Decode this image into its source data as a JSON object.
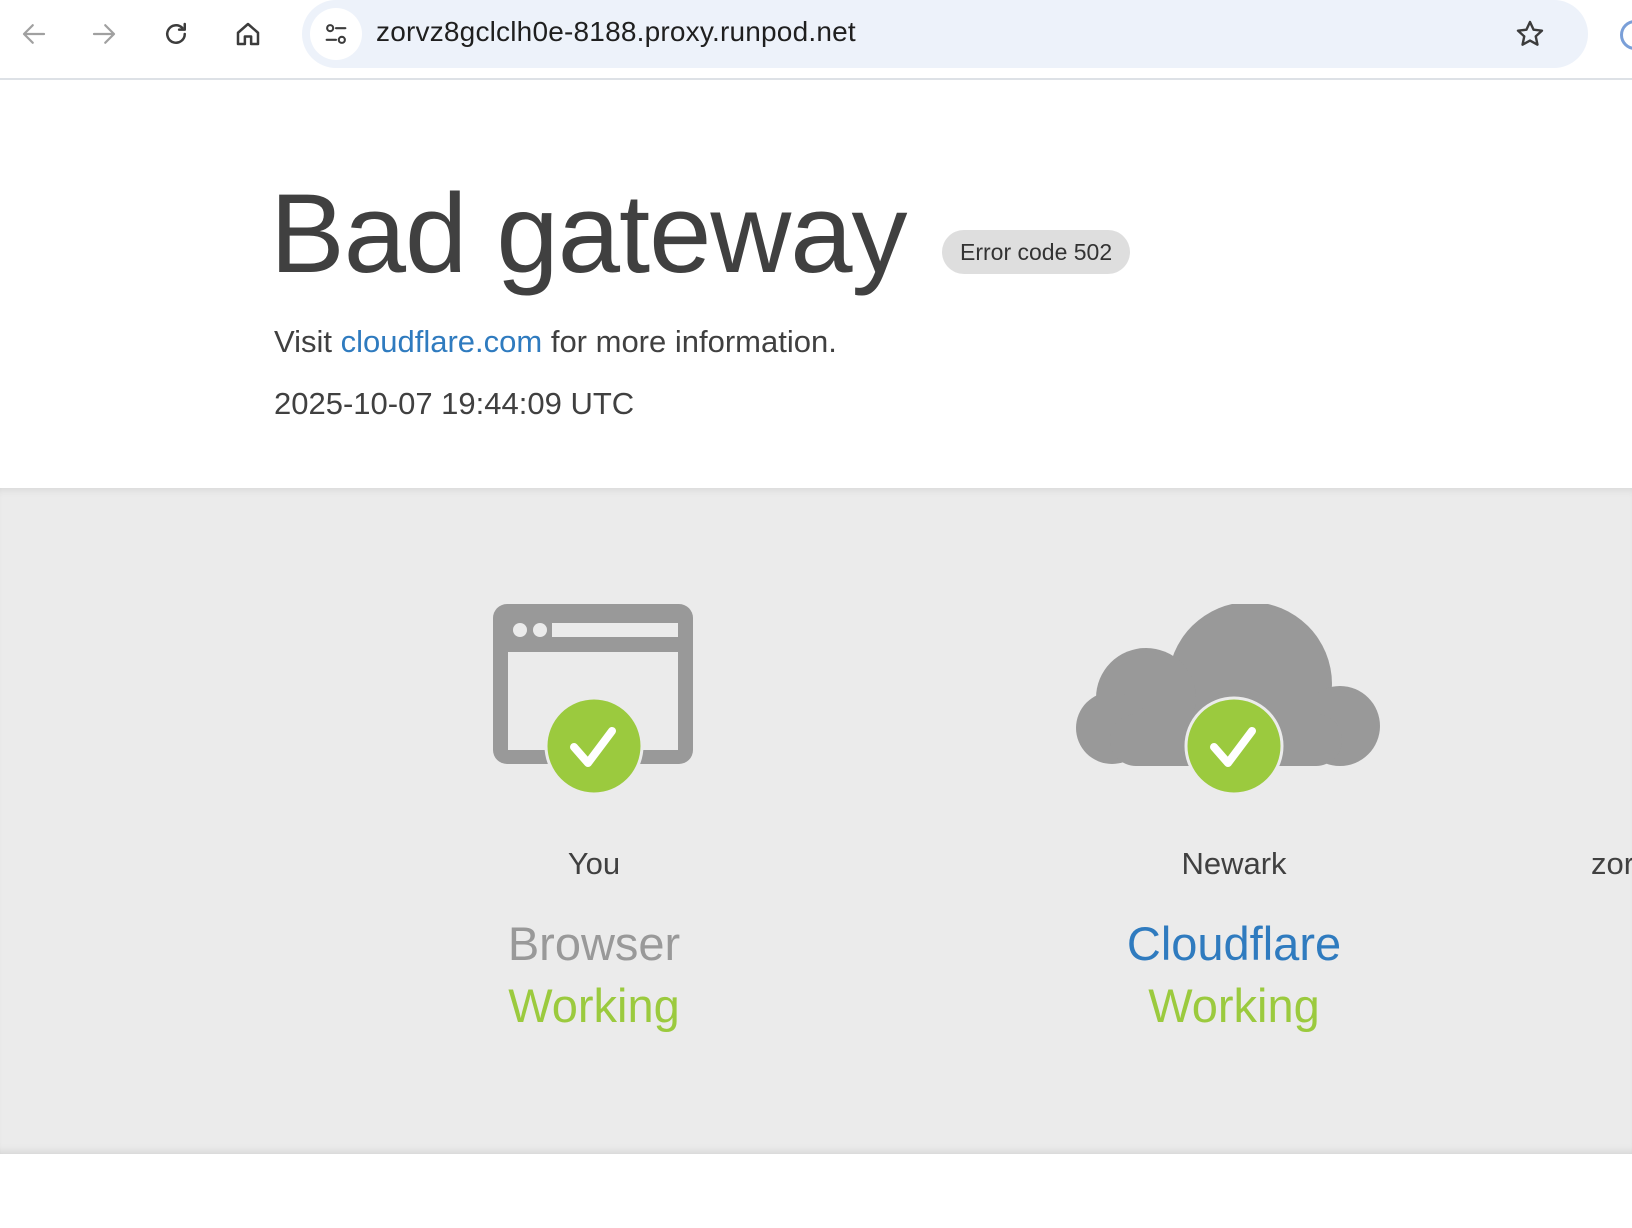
{
  "browser": {
    "url": "zorvz8gclclh0e-8188.proxy.runpod.net",
    "icons": [
      "back-arrow-icon",
      "forward-arrow-icon",
      "reload-icon",
      "home-icon",
      "site-info-icon",
      "star-icon"
    ]
  },
  "error": {
    "title": "Bad gateway",
    "code_badge": "Error code 502",
    "info_prefix": "Visit ",
    "info_link": "cloudflare.com",
    "info_suffix": " for more information.",
    "timestamp": "2025-10-07 19:44:09 UTC"
  },
  "nodes": [
    {
      "location": "You",
      "name": "Browser",
      "state": "Working",
      "icon": "browser-window-icon"
    },
    {
      "location": "Newark",
      "name": "Cloudflare",
      "state": "Working",
      "icon": "cloud-icon"
    },
    {
      "location": "zor"
    }
  ],
  "colors": {
    "link": "#2f7bbf",
    "working": "#9bca3e",
    "status_bg": "#ebebeb",
    "icon_gray": "#999999"
  }
}
